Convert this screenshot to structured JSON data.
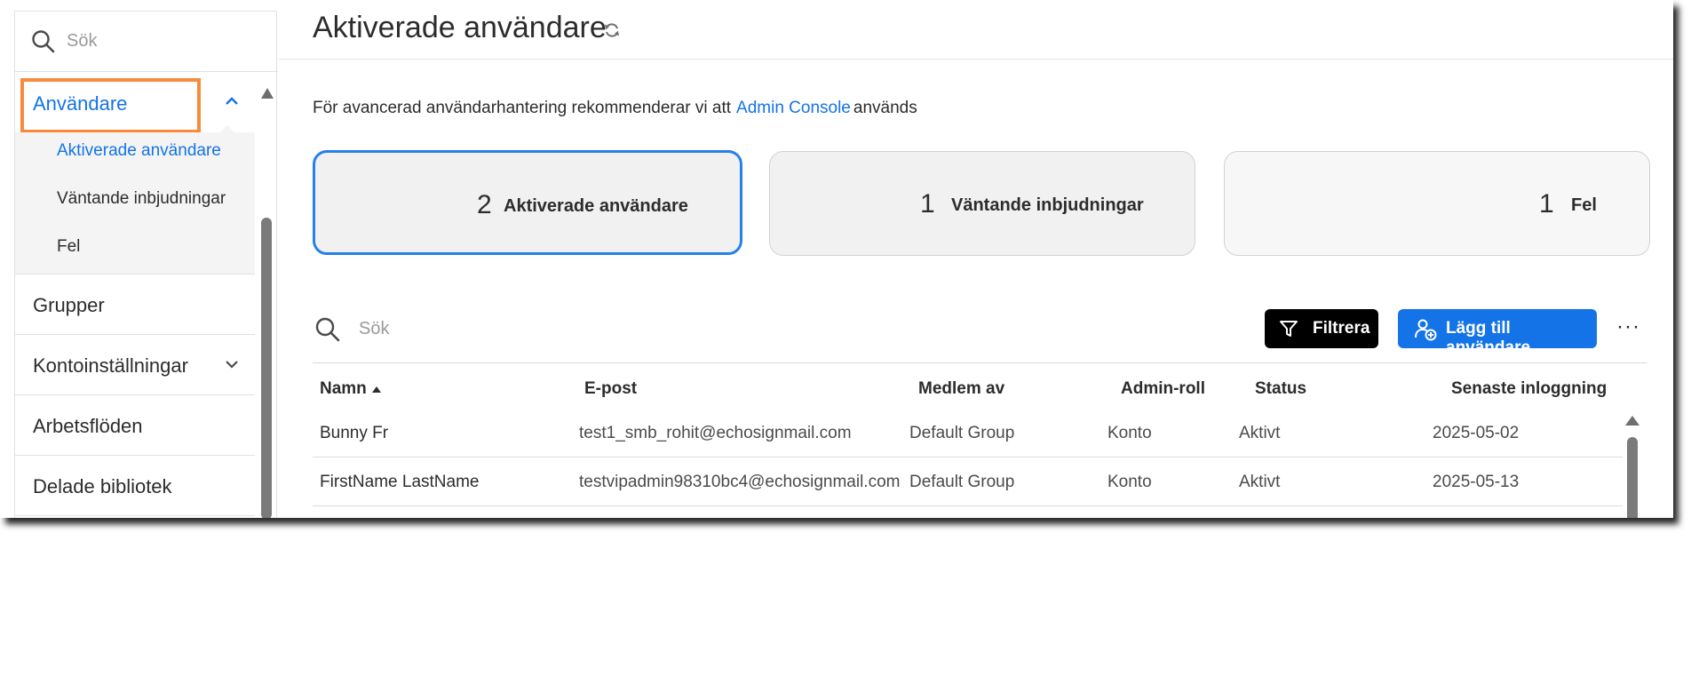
{
  "sidebar": {
    "search_placeholder": "Sök",
    "items": [
      {
        "label": "Användare",
        "expanded": true
      },
      {
        "label": "Grupper"
      },
      {
        "label": "Kontoinställningar",
        "expanded": false
      },
      {
        "label": "Arbetsflöden"
      },
      {
        "label": "Delade bibliotek"
      }
    ],
    "subitems": [
      {
        "label": "Aktiverade användare",
        "active": true
      },
      {
        "label": "Väntande inbjudningar"
      },
      {
        "label": "Fel"
      }
    ]
  },
  "header": {
    "title": "Aktiverade användare"
  },
  "info": {
    "prefix": "För avancerad användarhantering rekommenderar vi att",
    "link": "Admin Console",
    "suffix": "används"
  },
  "cards": [
    {
      "count": "2",
      "label": "Aktiverade användare",
      "selected": true
    },
    {
      "count": "1",
      "label": "Väntande inbjudningar"
    },
    {
      "count": "1",
      "label": "Fel"
    }
  ],
  "toolbar": {
    "search_placeholder": "Sök",
    "filter_label": "Filtrera",
    "add_label": "Lägg till användare",
    "more_label": "···"
  },
  "table": {
    "columns": [
      "Namn",
      "E-post",
      "Medlem av",
      "Admin-roll",
      "Status",
      "Senaste inloggning"
    ],
    "rows": [
      [
        "Bunny Fr",
        "test1_smb_rohit@echosignmail.com",
        "Default Group",
        "Konto",
        "Aktivt",
        "2025-05-02"
      ],
      [
        "FirstName LastName",
        "testvipadmin98310bc4@echosignmail.com",
        "Default Group",
        "Konto",
        "Aktivt",
        "2025-05-13"
      ]
    ]
  },
  "colors": {
    "accent": "#1473e6",
    "highlight": "#f98a3b",
    "selected_border": "#2680eb"
  }
}
